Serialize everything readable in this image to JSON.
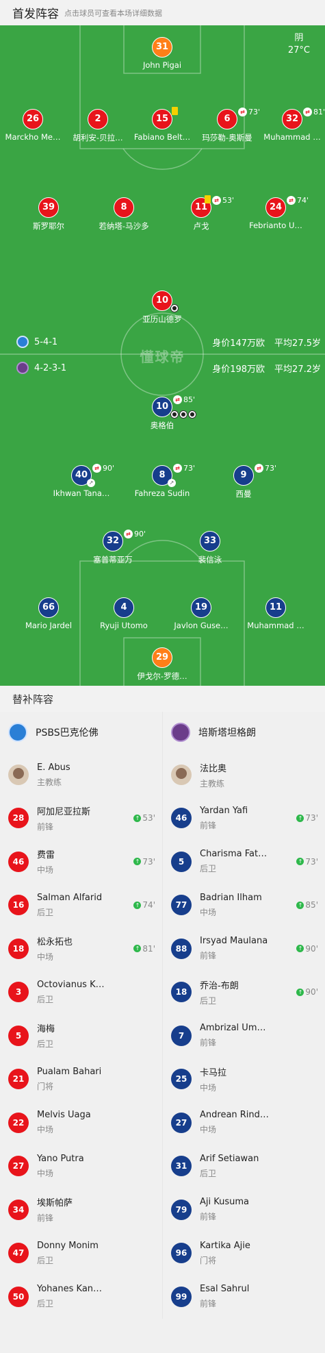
{
  "header": {
    "title": "首发阵容",
    "hint": "点击球员可查看本场详细数据"
  },
  "weather": {
    "condition": "阴",
    "temp": "27°C"
  },
  "watermark": "懂球帝",
  "home_team": {
    "formation": "5-4-1",
    "value": "身价147万欧",
    "avg_age": "平均27.5岁",
    "color": "#e8141b"
  },
  "away_team": {
    "formation": "4-2-3-1",
    "value": "身价198万欧",
    "avg_age": "平均27.2岁",
    "color": "#173e8c"
  },
  "home_players": [
    {
      "num": "31",
      "name": "John Pigai",
      "color": "orange"
    },
    {
      "num": "26",
      "name": "Marckho Me…"
    },
    {
      "num": "2",
      "name": "胡利安-贝拉…"
    },
    {
      "num": "15",
      "name": "Fabiano Belt…",
      "yellow": true
    },
    {
      "num": "6",
      "name": "玛莎勒-奥斯曼",
      "sub": "73'"
    },
    {
      "num": "32",
      "name": "Muhammad …",
      "sub": "81'"
    },
    {
      "num": "39",
      "name": "斯罗耶尔"
    },
    {
      "num": "8",
      "name": "若纳塔-马沙多"
    },
    {
      "num": "11",
      "name": "卢戈",
      "sub": "53'",
      "yellow": true
    },
    {
      "num": "24",
      "name": "Febrianto U…",
      "sub": "74'"
    },
    {
      "num": "10",
      "name": "亚历山德罗",
      "goals": 1
    }
  ],
  "away_players": [
    {
      "num": "10",
      "name": "奥格伯",
      "sub": "85'",
      "goals": 3
    },
    {
      "num": "40",
      "name": "Ikhwan Tana…",
      "sub": "90'",
      "assist": true
    },
    {
      "num": "8",
      "name": "Fahreza Sudin",
      "sub": "73'",
      "assist": true
    },
    {
      "num": "9",
      "name": "西曼",
      "sub": "73'"
    },
    {
      "num": "32",
      "name": "塞普蒂亚万",
      "sub": "90'"
    },
    {
      "num": "33",
      "name": "裴信泳"
    },
    {
      "num": "66",
      "name": "Mario Jardel"
    },
    {
      "num": "4",
      "name": "Ryuji Utomo"
    },
    {
      "num": "19",
      "name": "Javlon Guse…"
    },
    {
      "num": "11",
      "name": "Muhammad …"
    },
    {
      "num": "29",
      "name": "伊戈尔-罗德…",
      "color": "orange"
    }
  ],
  "subs": {
    "title": "替补阵容",
    "left": {
      "team_name": "PSBS巴克伦佛",
      "coach": {
        "name": "E. Abus",
        "role": "主教练"
      },
      "players": [
        {
          "num": "28",
          "name": "阿加尼亚拉斯",
          "pos": "前锋",
          "in": "53'"
        },
        {
          "num": "46",
          "name": "费雷",
          "pos": "中场",
          "in": "73'"
        },
        {
          "num": "16",
          "name": "Salman Alfarid",
          "pos": "后卫",
          "in": "74'"
        },
        {
          "num": "18",
          "name": "松永拓也",
          "pos": "中场",
          "in": "81'"
        },
        {
          "num": "3",
          "name": "Octovianus K…",
          "pos": "后卫"
        },
        {
          "num": "5",
          "name": "海梅",
          "pos": "后卫"
        },
        {
          "num": "21",
          "name": "Pualam Bahari",
          "pos": "门将"
        },
        {
          "num": "22",
          "name": "Melvis Uaga",
          "pos": "中场"
        },
        {
          "num": "27",
          "name": "Yano Putra",
          "pos": "中场"
        },
        {
          "num": "34",
          "name": "埃斯帕萨",
          "pos": "前锋"
        },
        {
          "num": "47",
          "name": "Donny Monim",
          "pos": "后卫"
        },
        {
          "num": "50",
          "name": "Yohanes Kan…",
          "pos": "后卫"
        }
      ]
    },
    "right": {
      "team_name": "培斯塔坦格朗",
      "coach": {
        "name": "法比奥",
        "role": "主教练"
      },
      "players": [
        {
          "num": "46",
          "name": "Yardan Yafi",
          "pos": "前锋",
          "in": "73'"
        },
        {
          "num": "5",
          "name": "Charisma Fat…",
          "pos": "后卫",
          "in": "73'"
        },
        {
          "num": "77",
          "name": "Badrian Ilham",
          "pos": "中场",
          "in": "85'"
        },
        {
          "num": "88",
          "name": "Irsyad Maulana",
          "pos": "前锋",
          "in": "90'"
        },
        {
          "num": "18",
          "name": "乔治-布朗",
          "pos": "后卫",
          "in": "90'"
        },
        {
          "num": "7",
          "name": "Ambrizal Um…",
          "pos": "前锋"
        },
        {
          "num": "25",
          "name": "卡马拉",
          "pos": "中场"
        },
        {
          "num": "27",
          "name": "Andrean Rind…",
          "pos": "中场"
        },
        {
          "num": "31",
          "name": "Arif Setiawan",
          "pos": "后卫"
        },
        {
          "num": "79",
          "name": "Aji Kusuma",
          "pos": "前锋"
        },
        {
          "num": "96",
          "name": "Kartika Ajie",
          "pos": "门将"
        },
        {
          "num": "99",
          "name": "Esal Sahrul",
          "pos": "前锋"
        }
      ]
    }
  }
}
